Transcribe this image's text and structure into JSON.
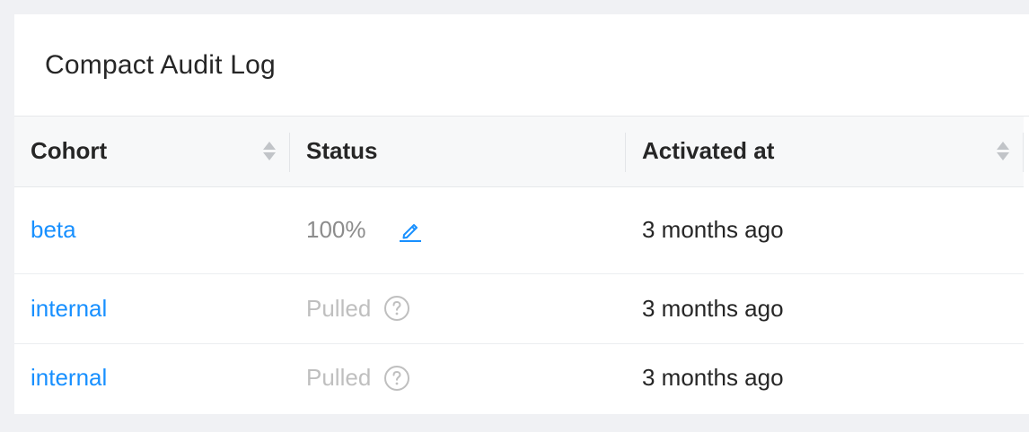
{
  "card": {
    "title": "Compact Audit Log"
  },
  "table": {
    "columns": [
      {
        "label": "Cohort",
        "sortable": true
      },
      {
        "label": "Status",
        "sortable": false
      },
      {
        "label": "Activated at",
        "sortable": true
      }
    ],
    "rows": [
      {
        "cohort": "beta",
        "status": "100%",
        "status_kind": "percent",
        "status_icon": "edit-icon",
        "activated": "3 months ago"
      },
      {
        "cohort": "internal",
        "status": "Pulled",
        "status_kind": "pulled",
        "status_icon": "help-icon",
        "activated": "3 months ago"
      },
      {
        "cohort": "internal",
        "status": "Pulled",
        "status_kind": "pulled",
        "status_icon": "help-icon",
        "activated": "3 months ago"
      }
    ]
  },
  "colors": {
    "link": "#1890ff",
    "status_percent": "#8c8c8c",
    "status_pulled": "#bfbfbf",
    "header_bg": "#f7f8f9",
    "page_bg": "#f0f1f4"
  }
}
